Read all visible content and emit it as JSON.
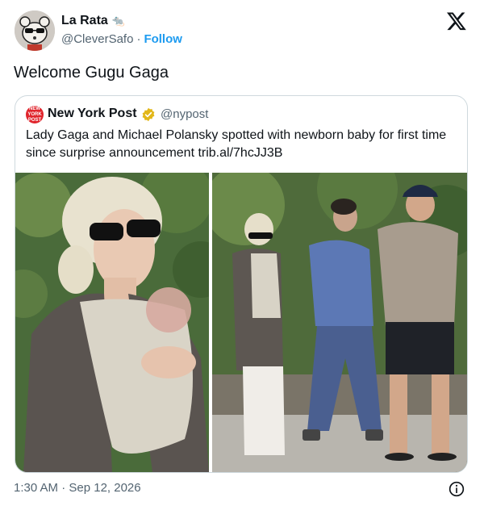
{
  "author": {
    "name": "La Rata",
    "name_emoji": "🐀",
    "handle": "@CleverSafo",
    "separator": "·",
    "follow_label": "Follow"
  },
  "tweet": {
    "text": "Welcome Gugu Gaga",
    "timestamp": "1:30 AM · Sep 12, 2026"
  },
  "quote": {
    "logo_text": "NEW YORK POST",
    "name": "New York Post",
    "handle": "@nypost",
    "text": "Lady Gaga and Michael Polansky spotted with newborn baby for first time since surprise announcement trib.al/7hcJJ3B"
  },
  "icons": {
    "close": "x-logo-icon",
    "verified": "verified-badge-icon",
    "info": "info-icon"
  },
  "colors": {
    "accent": "#1d9bf0",
    "secondary_text": "#536471",
    "border": "#cfd9de",
    "verified_gold": "#e2b719",
    "post_red": "#e0242c"
  }
}
